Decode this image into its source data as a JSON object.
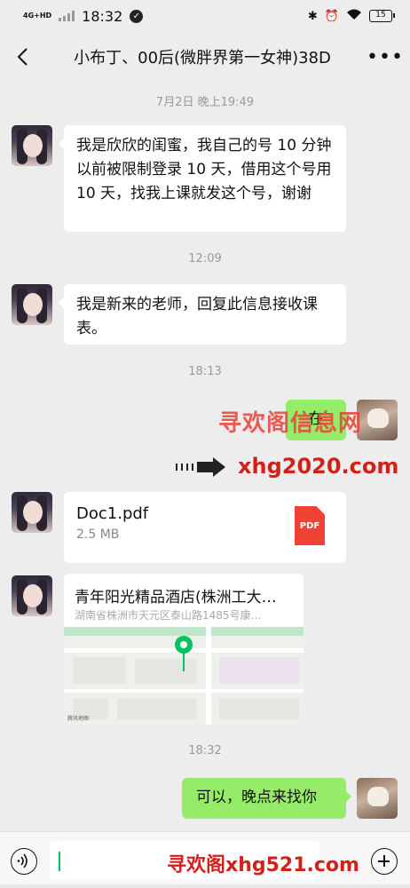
{
  "status_bar": {
    "network": "4G+HD",
    "time": "18:32",
    "battery": "15",
    "icons": [
      "signal-icon",
      "check-circle-icon",
      "bluetooth-icon",
      "alarm-icon",
      "wifi-icon",
      "battery-icon"
    ]
  },
  "header": {
    "title": "小布丁、00后(微胖界第一女神)38D",
    "back_icon": "chevron-left-icon",
    "more_icon": "more-dots-icon"
  },
  "messages": [
    {
      "type": "timestamp",
      "text": "7月2日 晚上19:49"
    },
    {
      "type": "text",
      "side": "left",
      "text": "我是欣欣的闺蜜，我自己的号 10 分钟以前被限制登录 10 天，借用这个号用 10 天，找我上课就发这个号，谢谢"
    },
    {
      "type": "timestamp",
      "text": "12:09"
    },
    {
      "type": "text",
      "side": "left",
      "text": "我是新来的老师，回复此信息接收课表。"
    },
    {
      "type": "timestamp",
      "text": "18:13"
    },
    {
      "type": "text",
      "side": "right",
      "text": "在"
    },
    {
      "type": "file",
      "side": "left",
      "file_name": "Doc1.pdf",
      "file_size": "2.5 MB",
      "file_icon_label": "PDF"
    },
    {
      "type": "location",
      "side": "left",
      "name": "青年阳光精品酒店(株洲工大…",
      "address": "湖南省株洲市天元区泰山路1485号康…",
      "map_label": "腾讯地图"
    },
    {
      "type": "timestamp",
      "text": "18:32"
    },
    {
      "type": "text",
      "side": "right",
      "text": "可以，晚点来找你"
    }
  ],
  "watermarks": {
    "top": "寻欢阁信息网",
    "middle": "xhg2020.com",
    "bottom": "寻欢阁xhg521.com"
  },
  "input_bar": {
    "voice_icon": "voice-icon",
    "emoji_icon": "emoji-icon",
    "plus_icon": "plus-circle-icon",
    "value": ""
  },
  "colors": {
    "background": "#ededed",
    "bubble_self": "#95ec69",
    "bubble_other": "#ffffff",
    "accent": "#07c160",
    "watermark": "#d4201a"
  }
}
